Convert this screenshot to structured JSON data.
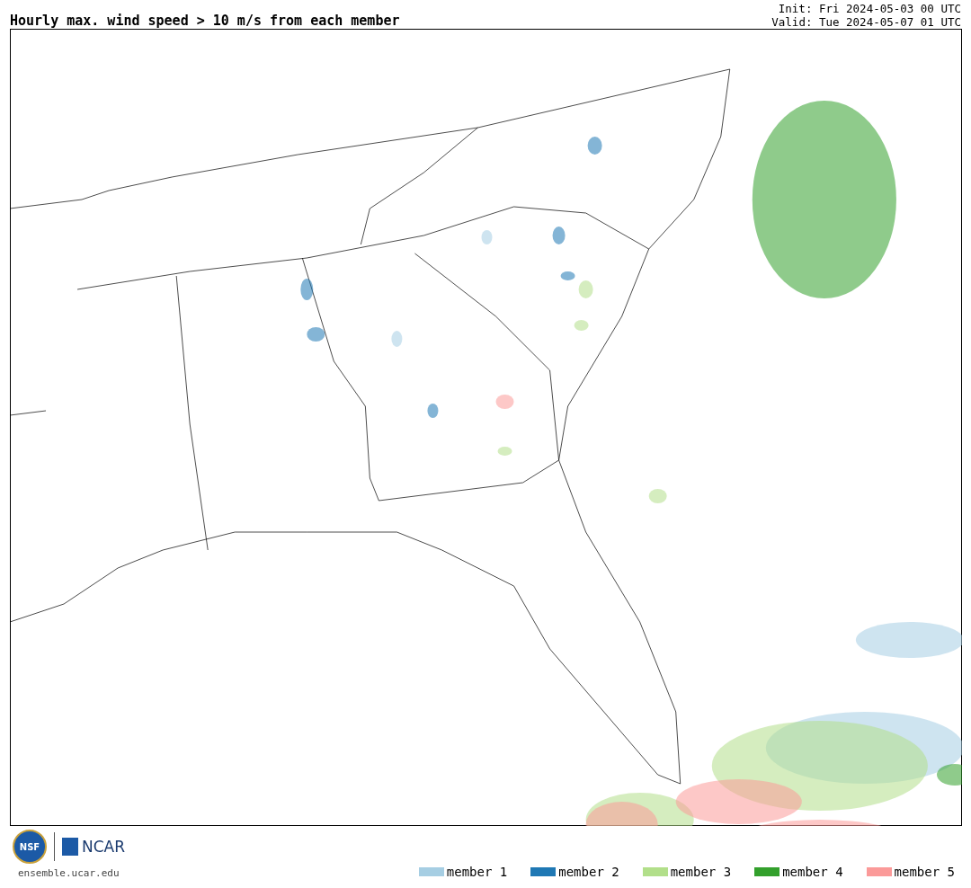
{
  "title": "Hourly max. wind speed > 10 m/s from each member",
  "init": "Init: Fri 2024-05-03 00 UTC",
  "valid": "Valid: Tue 2024-05-07 01 UTC",
  "logos": {
    "nsf": "NSF",
    "ncar": "NCAR"
  },
  "site": "ensemble.ucar.edu",
  "legend": [
    {
      "label": "member 1",
      "color": "#a6cee3"
    },
    {
      "label": "member 2",
      "color": "#1f78b4"
    },
    {
      "label": "member 3",
      "color": "#b2df8a"
    },
    {
      "label": "member 4",
      "color": "#33a02c"
    },
    {
      "label": "member 5",
      "color": "#fb9a99"
    }
  ]
}
